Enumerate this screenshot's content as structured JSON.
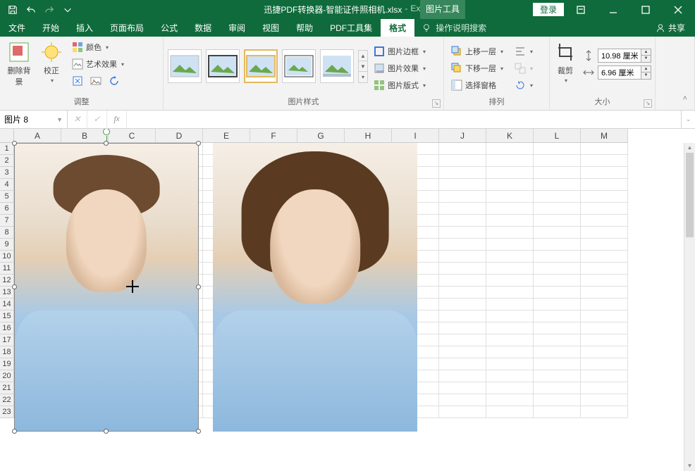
{
  "title": {
    "filename": "迅捷PDF转换器-智能证件照相机.xlsx",
    "appname": "Excel",
    "context_tool": "图片工具",
    "login": "登录"
  },
  "tabs": [
    "文件",
    "开始",
    "插入",
    "页面布局",
    "公式",
    "数据",
    "审阅",
    "视图",
    "帮助",
    "PDF工具集",
    "格式"
  ],
  "tellme": "操作说明搜索",
  "share": "共享",
  "ribbon": {
    "g_adjust": {
      "label": "调整",
      "remove_bg": "删除背景",
      "corrections": "校正",
      "color": "颜色",
      "artistic": "艺术效果"
    },
    "g_styles": {
      "label": "图片样式",
      "border": "图片边框",
      "effects": "图片效果",
      "layout": "图片版式"
    },
    "g_arrange": {
      "label": "排列",
      "forward": "上移一层",
      "backward": "下移一层",
      "pane": "选择窗格"
    },
    "g_size": {
      "label": "大小",
      "crop": "裁剪",
      "height": "10.98 厘米",
      "width": "6.96 厘米"
    }
  },
  "fbar": {
    "name": "图片 8"
  },
  "grid": {
    "cols": [
      "A",
      "B",
      "C",
      "D",
      "E",
      "F",
      "G",
      "H",
      "I",
      "J",
      "K",
      "L",
      "M"
    ],
    "rows": 23
  }
}
